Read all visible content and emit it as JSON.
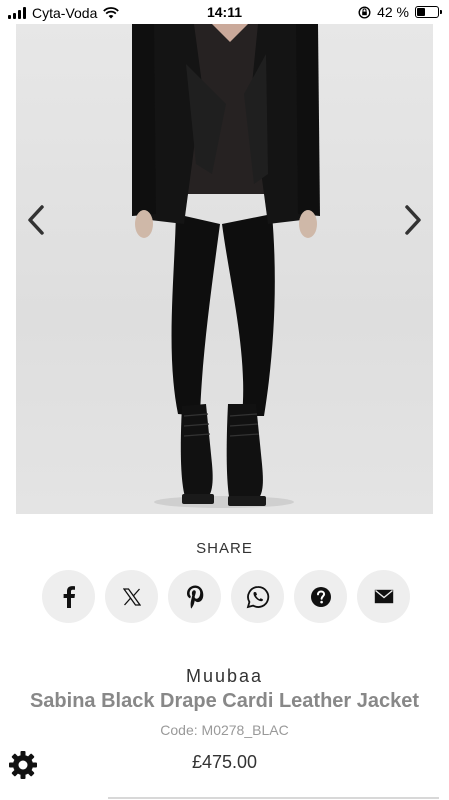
{
  "status_bar": {
    "carrier": "Cyta-Voda",
    "time": "14:11",
    "battery_percent": "42 %",
    "battery_level": 0.42
  },
  "gallery": {
    "prev_icon": "chevron-left-icon",
    "next_icon": "chevron-right-icon"
  },
  "share": {
    "title": "SHARE",
    "buttons": [
      {
        "icon": "facebook-icon"
      },
      {
        "icon": "x-twitter-icon"
      },
      {
        "icon": "pinterest-icon"
      },
      {
        "icon": "whatsapp-icon"
      },
      {
        "icon": "question-icon"
      },
      {
        "icon": "email-icon"
      }
    ]
  },
  "product": {
    "brand": "Muubaa",
    "name": "Sabina Black Drape Cardi Leather Jacket",
    "code": "Code: M0278_BLAC",
    "price": "£475.00"
  },
  "settings": {
    "icon": "gear-icon"
  }
}
